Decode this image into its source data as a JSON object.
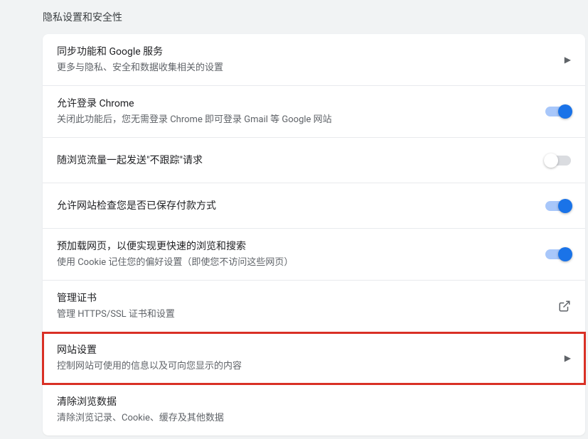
{
  "section_title": "隐私设置和安全性",
  "rows": [
    {
      "title": "同步功能和 Google 服务",
      "subtitle": "更多与隐私、安全和数据收集相关的设置",
      "control": "arrow"
    },
    {
      "title": "允许登录 Chrome",
      "subtitle": "关闭此功能后，您无需登录 Chrome 即可登录 Gmail 等 Google 网站",
      "control": "toggle",
      "enabled": true
    },
    {
      "title": "随浏览流量一起发送\"不跟踪\"请求",
      "subtitle": "",
      "control": "toggle",
      "enabled": false
    },
    {
      "title": "允许网站检查您是否已保存付款方式",
      "subtitle": "",
      "control": "toggle",
      "enabled": true
    },
    {
      "title": "预加载网页，以便实现更快速的浏览和搜索",
      "subtitle": "使用 Cookie 记住您的偏好设置（即使您不访问这些网页）",
      "control": "toggle",
      "enabled": true
    },
    {
      "title": "管理证书",
      "subtitle": "管理 HTTPS/SSL 证书和设置",
      "control": "external"
    },
    {
      "title": "网站设置",
      "subtitle": "控制网站可使用的信息以及可向您显示的内容",
      "control": "arrow",
      "highlighted": true
    },
    {
      "title": "清除浏览数据",
      "subtitle": "清除浏览记录、Cookie、缓存及其他数据",
      "control": "arrow"
    }
  ]
}
